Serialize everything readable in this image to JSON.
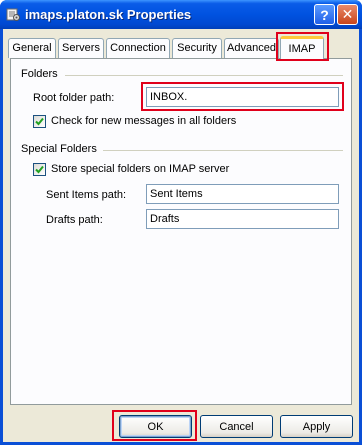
{
  "window": {
    "title": "imaps.platon.sk Properties",
    "help_glyph": "?",
    "close_glyph": "✕",
    "icon": "properties-icon"
  },
  "tabs": [
    {
      "label": "General"
    },
    {
      "label": "Servers"
    },
    {
      "label": "Connection"
    },
    {
      "label": "Security"
    },
    {
      "label": "Advanced"
    },
    {
      "label": "IMAP",
      "active": true
    }
  ],
  "folders": {
    "group_label": "Folders",
    "root_folder_label": "Root folder path:",
    "root_folder_value": "INBOX.",
    "check_new_label": "Check for new messages in all folders",
    "check_new_checked": true
  },
  "special_folders": {
    "group_label": "Special Folders",
    "store_label": "Store special folders on IMAP server",
    "store_checked": true,
    "sent_label": "Sent Items path:",
    "sent_value": "Sent Items",
    "drafts_label": "Drafts path:",
    "drafts_value": "Drafts"
  },
  "buttons": {
    "ok": "OK",
    "cancel": "Cancel",
    "apply": "Apply"
  },
  "colors": {
    "highlight": "#e0001b",
    "titlebar": "#0052e0",
    "dialog_bg": "#ece9d8",
    "active_tab_accent": "#ffc83c"
  }
}
